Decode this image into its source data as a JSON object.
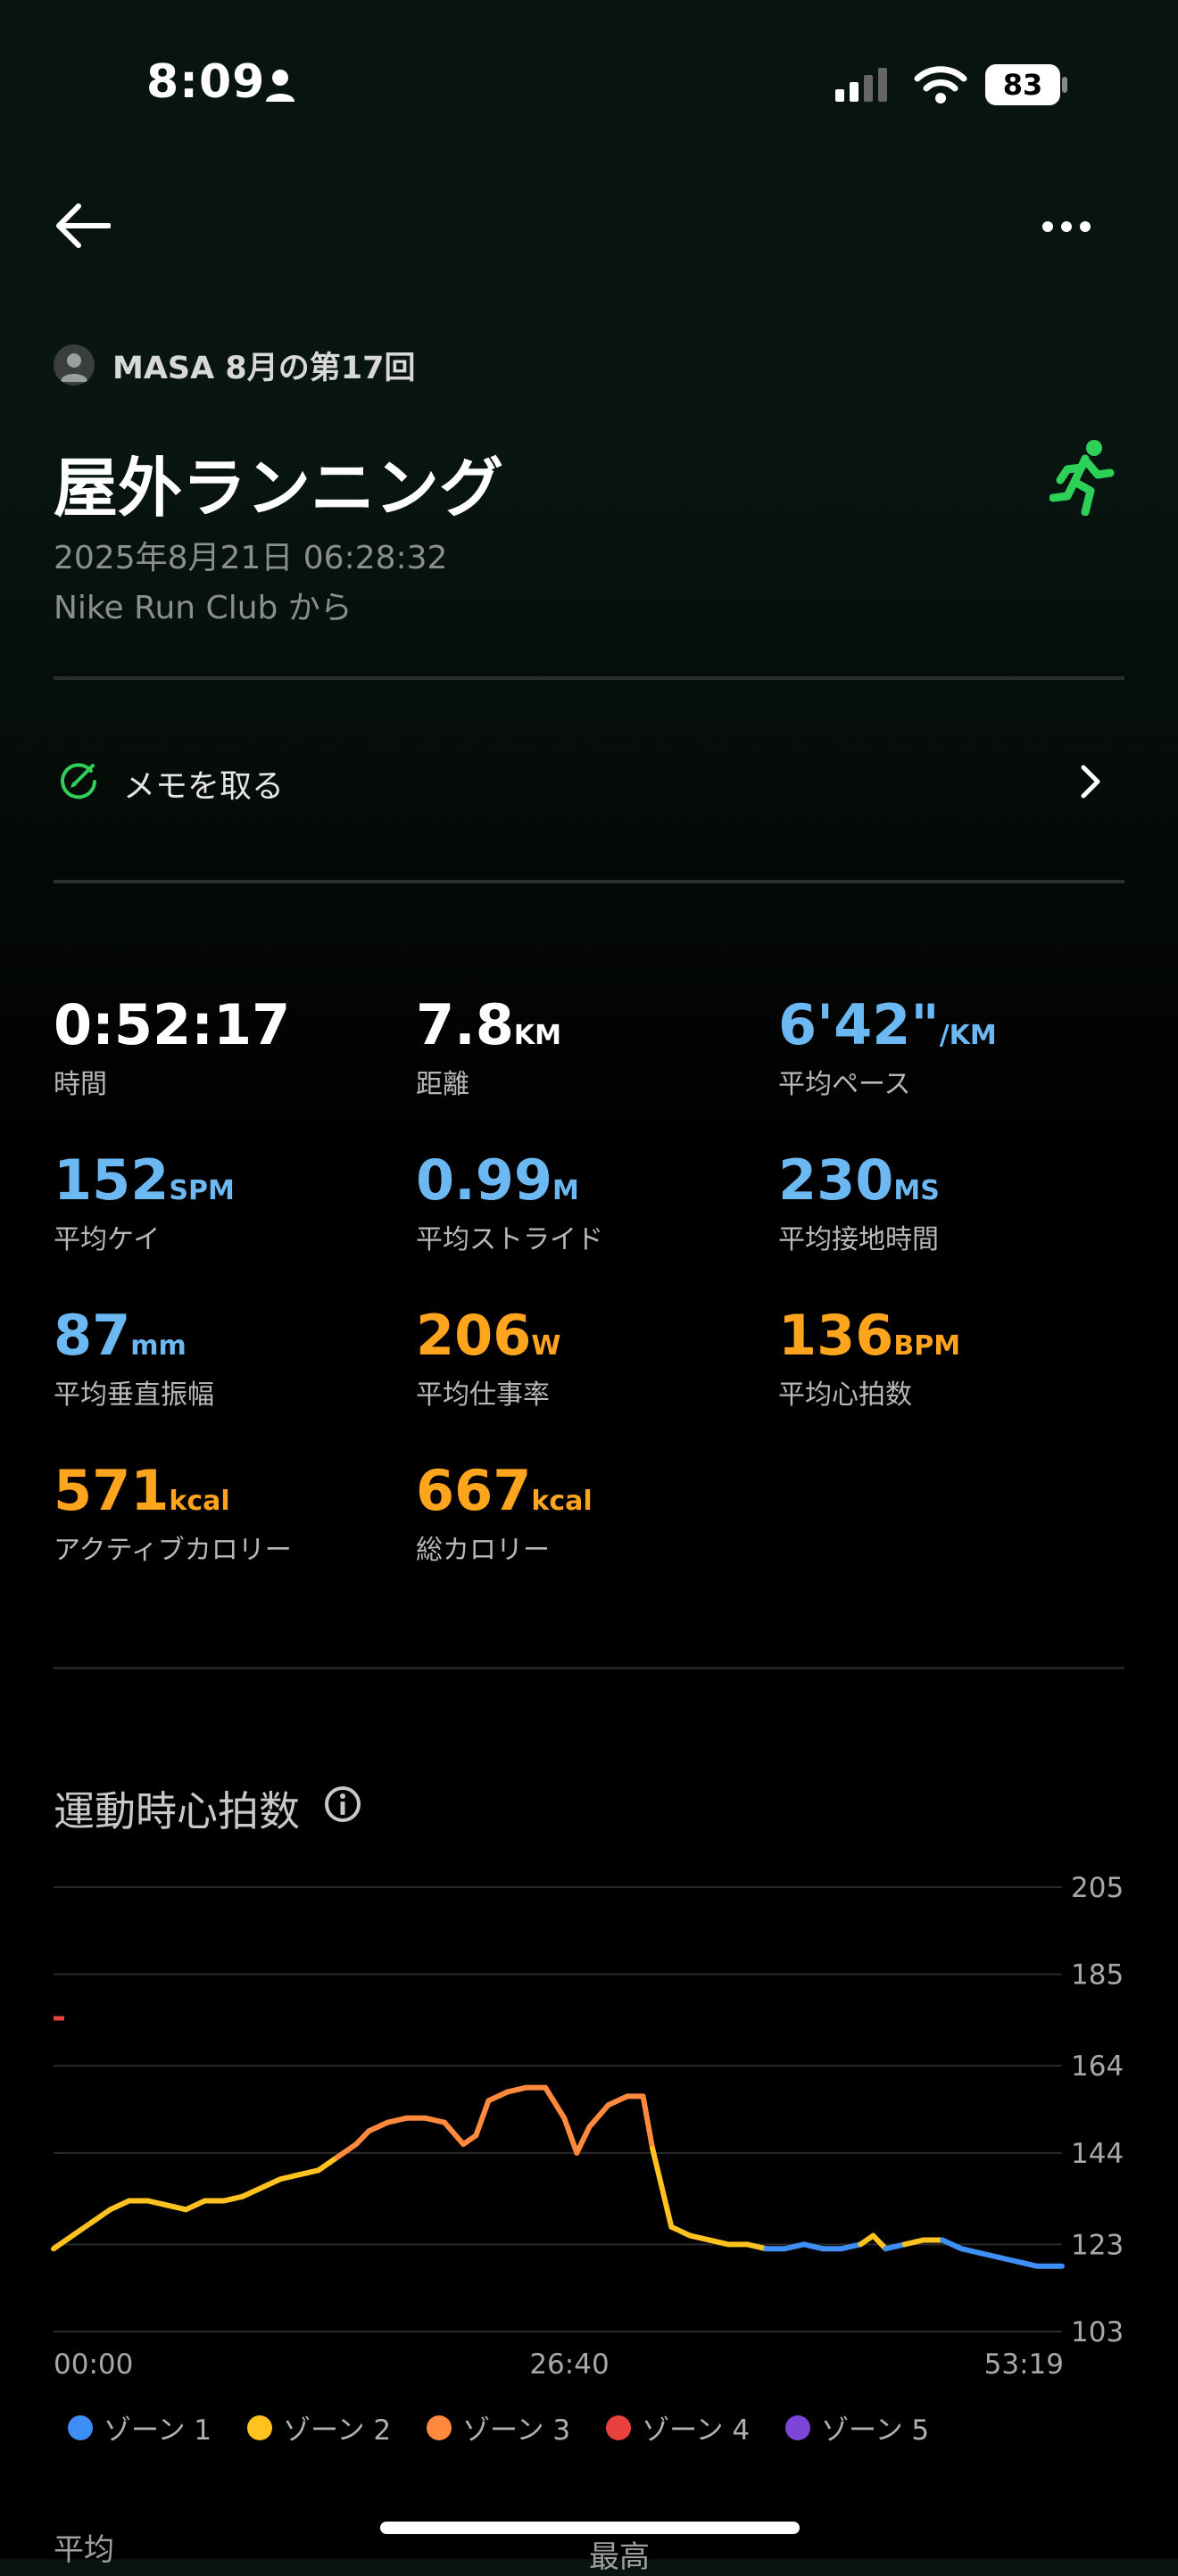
{
  "status_bar": {
    "time": "8:09",
    "battery": "83"
  },
  "header": {
    "owner": "MASA 8月の第17回"
  },
  "workout": {
    "title": "屋外ランニング",
    "date": "2025年8月21日 06:28:32",
    "source": "Nike Run Club から"
  },
  "memo": {
    "label": "メモを取る"
  },
  "stats": [
    {
      "value": "0:52:17",
      "unit": "",
      "label": "時間",
      "color": "#ffffff"
    },
    {
      "value": "7.8",
      "unit": "KM",
      "label": "距離",
      "color": "#ffffff"
    },
    {
      "value": "6'42\"",
      "unit": "/KM",
      "label": "平均ペース",
      "color": "#6cb8f2"
    },
    {
      "value": "152",
      "unit": "SPM",
      "label": "平均ケイ",
      "color": "#6cb8f2"
    },
    {
      "value": "0.99",
      "unit": "M",
      "label": "平均ストライド",
      "color": "#6cb8f2"
    },
    {
      "value": "230",
      "unit": "MS",
      "label": "平均接地時間",
      "color": "#6cb8f2"
    },
    {
      "value": "87",
      "unit": "mm",
      "label": "平均垂直振幅",
      "color": "#6cb8f2"
    },
    {
      "value": "206",
      "unit": "W",
      "label": "平均仕事率",
      "color": "#ffa41d"
    },
    {
      "value": "136",
      "unit": "BPM",
      "label": "平均心拍数",
      "color": "#ffa41d"
    },
    {
      "value": "571",
      "unit": "kcal",
      "label": "アクティブカロリー",
      "color": "#ffa41d"
    },
    {
      "value": "667",
      "unit": "kcal",
      "label": "総カロリー",
      "color": "#ffa41d"
    }
  ],
  "heart_rate": {
    "title": "運動時心拍数"
  },
  "chart_data": {
    "type": "line",
    "y_ticks": [
      "205",
      "185",
      "164",
      "144",
      "123",
      "103"
    ],
    "x_ticks": [
      "00:00",
      "26:40",
      "53:19"
    ],
    "ylim": [
      103,
      205
    ],
    "xlim": [
      0,
      3199
    ],
    "series": [
      {
        "values": [
          [
            0,
            122
          ],
          [
            60,
            125
          ],
          [
            120,
            128
          ],
          [
            180,
            131
          ],
          [
            240,
            133
          ],
          [
            300,
            133
          ],
          [
            360,
            132
          ],
          [
            420,
            131
          ],
          [
            480,
            133
          ],
          [
            540,
            133
          ],
          [
            600,
            134
          ],
          [
            660,
            136
          ],
          [
            720,
            138
          ],
          [
            780,
            139
          ],
          [
            840,
            140
          ],
          [
            900,
            143
          ],
          [
            960,
            146
          ],
          [
            1000,
            149
          ],
          [
            1060,
            151
          ],
          [
            1120,
            152
          ],
          [
            1180,
            152
          ],
          [
            1240,
            151
          ],
          [
            1300,
            146
          ],
          [
            1340,
            148
          ],
          [
            1380,
            156
          ],
          [
            1440,
            158
          ],
          [
            1500,
            159
          ],
          [
            1560,
            159
          ],
          [
            1620,
            152
          ],
          [
            1660,
            144
          ],
          [
            1700,
            150
          ],
          [
            1760,
            155
          ],
          [
            1820,
            157
          ],
          [
            1870,
            157
          ],
          [
            1900,
            145
          ],
          [
            1960,
            127
          ],
          [
            2020,
            125
          ],
          [
            2080,
            124
          ],
          [
            2140,
            123
          ],
          [
            2200,
            123
          ],
          [
            2260,
            122
          ],
          [
            2320,
            122
          ],
          [
            2380,
            123
          ],
          [
            2440,
            122
          ],
          [
            2500,
            122
          ],
          [
            2560,
            123
          ],
          [
            2600,
            125
          ],
          [
            2640,
            122
          ],
          [
            2700,
            123
          ],
          [
            2760,
            124
          ],
          [
            2820,
            124
          ],
          [
            2880,
            122
          ],
          [
            2940,
            121
          ],
          [
            3000,
            120
          ],
          [
            3060,
            119
          ],
          [
            3120,
            118
          ],
          [
            3199,
            118
          ]
        ]
      }
    ],
    "marker": {
      "x": 0,
      "y": 175
    }
  },
  "legend": [
    {
      "label": "ゾーン 1",
      "color": "#3d8ef5"
    },
    {
      "label": "ゾーン 2",
      "color": "#ffc21f"
    },
    {
      "label": "ゾーン 3",
      "color": "#ff8a3d"
    },
    {
      "label": "ゾーン 4",
      "color": "#e8413e"
    },
    {
      "label": "ゾーン 5",
      "color": "#7a45d8"
    }
  ],
  "summary": {
    "avg_label": "平均",
    "max_label": "最高"
  }
}
